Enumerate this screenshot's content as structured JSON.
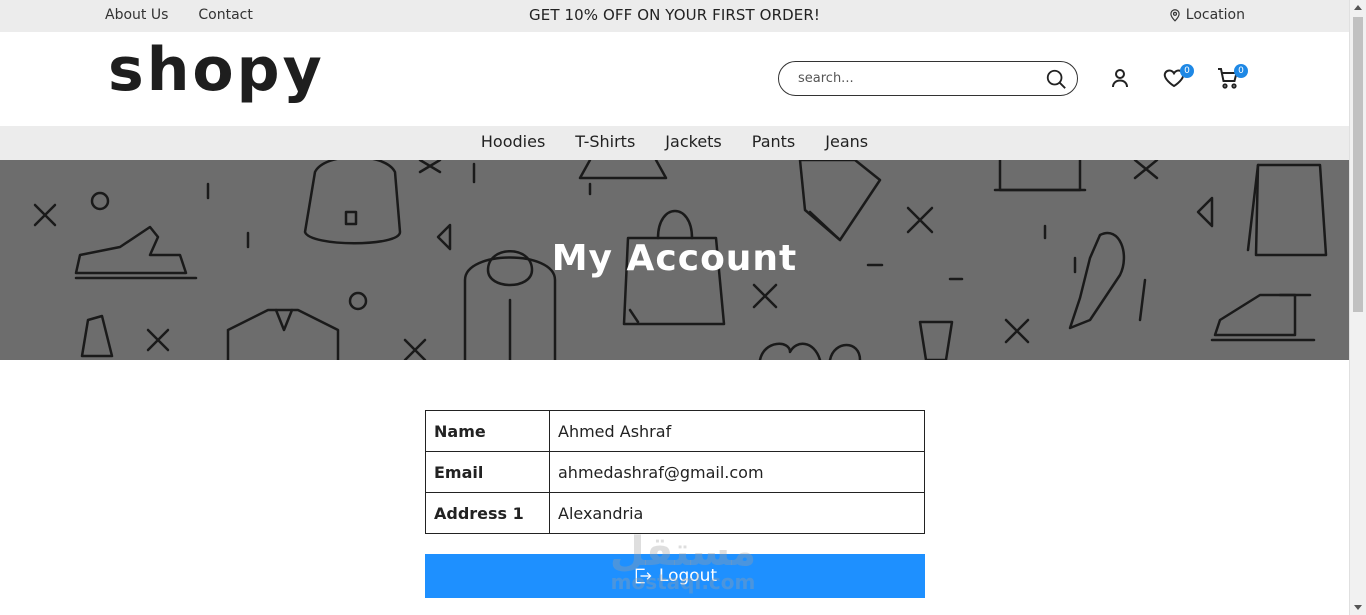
{
  "topbar": {
    "links": [
      "About Us",
      "Contact"
    ],
    "promo": "GET 10% OFF ON YOUR FIRST ORDER!",
    "location": "Location",
    "location_icon": "map-pin-icon"
  },
  "header": {
    "logo": "shopy",
    "search_placeholder": "search...",
    "wishlist_count": "0",
    "cart_count": "0"
  },
  "nav": {
    "items": [
      "Hoodies",
      "T-Shirts",
      "Jackets",
      "Pants",
      "Jeans"
    ]
  },
  "banner": {
    "title": "My Account"
  },
  "account": {
    "rows": [
      {
        "label": "Name",
        "value": "Ahmed Ashraf"
      },
      {
        "label": "Email",
        "value": "ahmedashraf@gmail.com"
      },
      {
        "label": "Address 1",
        "value": "Alexandria"
      }
    ]
  },
  "logout": {
    "label": "Logout",
    "color": "#1e90ff"
  },
  "watermark": {
    "arabic": "مستقل",
    "latin": "mostaql.com"
  }
}
